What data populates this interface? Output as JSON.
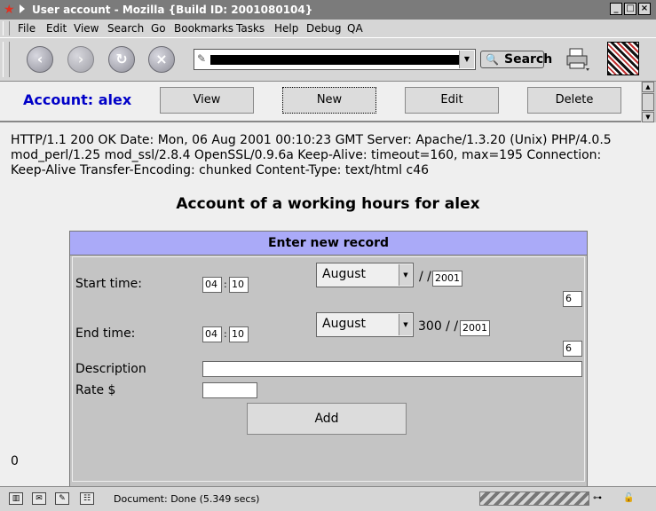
{
  "window": {
    "title": "User account - Mozilla {Build ID: 2001080104}",
    "app_icon": "mozilla-star-icon",
    "controls": {
      "minimize": "_",
      "maximize": "□",
      "close": "×"
    }
  },
  "menu": {
    "items": [
      "File",
      "Edit",
      "View",
      "Search",
      "Go",
      "Bookmarks",
      "Tasks",
      "Help",
      "Debug",
      "QA"
    ]
  },
  "toolbar": {
    "back_icon": "back-arrow-icon",
    "forward_icon": "forward-arrow-icon",
    "reload_icon": "reload-icon",
    "stop_icon": "stop-icon",
    "search_label": "Search",
    "print_icon": "printer-icon",
    "throbber_icon": "mozilla-throbber-icon"
  },
  "top_frame": {
    "account_label": "Account: alex",
    "buttons": {
      "view": "View",
      "new": "New",
      "edit": "Edit",
      "delete": "Delete"
    }
  },
  "main": {
    "http_text": "HTTP/1.1 200 OK Date: Mon, 06 Aug 2001 00:10:23 GMT Server: Apache/1.3.20 (Unix) PHP/4.0.5 mod_perl/1.25 mod_ssl/2.8.4 OpenSSL/0.9.6a Keep-Alive: timeout=160, max=195 Connection: Keep-Alive Transfer-Encoding: chunked Content-Type: text/html c46",
    "heading": "Account of a working hours for alex",
    "form": {
      "header": "Enter new record",
      "start": {
        "label": "Start time:",
        "hour": "04",
        "colon": ":",
        "minute": "10",
        "month": "August",
        "slashes": "/ /",
        "year": "2001",
        "day": "6"
      },
      "end": {
        "label": "End time:",
        "hour": "04",
        "colon": ":",
        "minute": "10",
        "month": "August",
        "slashes": "300 / /",
        "year": "2001",
        "day": "6"
      },
      "description_label": "Description",
      "description_value": "",
      "rate_label": "Rate $",
      "rate_value": "",
      "add_label": "Add"
    },
    "footer_value": "0"
  },
  "status": {
    "text": "Document: Done (5.349 secs)",
    "icons": [
      "navigator-icon",
      "mail-icon",
      "composer-icon",
      "addressbook-icon"
    ]
  }
}
